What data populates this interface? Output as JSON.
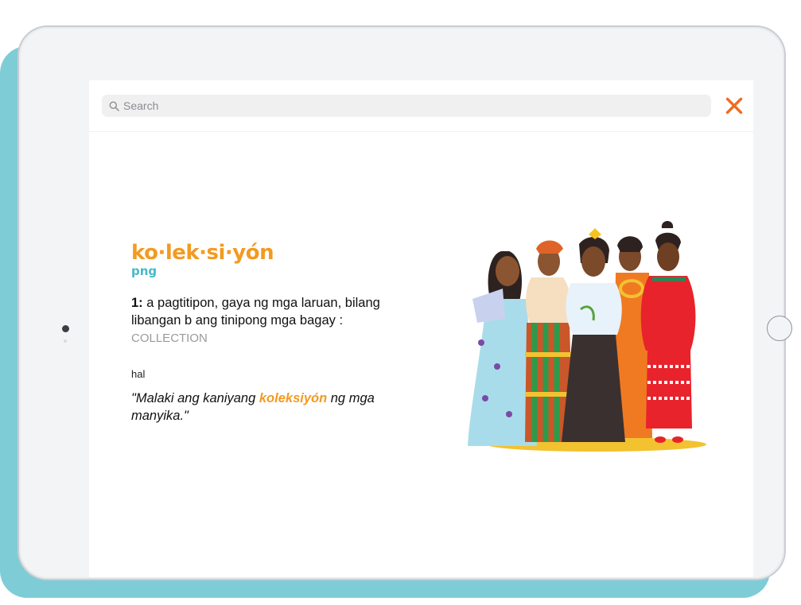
{
  "search": {
    "placeholder": "Search"
  },
  "close": {
    "label": "✕"
  },
  "entry": {
    "headword": "ko·lek·si·yón",
    "part_of_speech": "png",
    "definition_number": "1:",
    "definition_text": " a pagtitipon, gaya ng mga laruan, bilang libangan b ang tinipong mga bagay : ",
    "cross_reference": "COLLECTION",
    "example_label": "hal",
    "example_before": "\"Malaki ang kaniyang ",
    "example_keyword": "koleksiyón",
    "example_after": " ng mga manyika.\""
  },
  "colors": {
    "accent_orange": "#f39a21",
    "accent_teal": "#46b9c8",
    "close_orange": "#ef6c1e",
    "backdrop_teal": "#7ecdd6"
  },
  "icons": {
    "search": "search-icon",
    "close": "close-icon",
    "illustration": "five-women-traditional-dress-illustration"
  }
}
